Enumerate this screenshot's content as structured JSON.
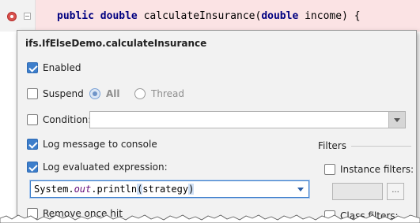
{
  "editor": {
    "code_kw1": "public",
    "code_kw2": "double",
    "code_fn": " calculateInsurance(",
    "code_kw3": "double",
    "code_rest": " income) {"
  },
  "popup": {
    "title": "ifs.IfElseDemo.calculateInsurance",
    "enabled_label": "Enabled",
    "enabled_checked": true,
    "suspend_label": "Suspend",
    "suspend_checked": false,
    "all_label": "All",
    "thread_label": "Thread",
    "suspend_policy": "All",
    "condition_label": "Condition:",
    "condition_checked": false,
    "condition_value": "",
    "log_message_label": "Log message to console",
    "log_message_checked": true,
    "log_expression_label": "Log evaluated expression:",
    "log_expression_checked": true,
    "expression": {
      "prefix": "System.",
      "out": "out",
      "middle": ".println",
      "paren_open": "(",
      "arg": "strategy",
      "paren_close": ")"
    },
    "remove_once_hit_label": "Remove once hit",
    "remove_once_hit_checked": false,
    "filters_heading": "Filters",
    "instance_filters_label": "Instance filters:",
    "instance_filters_checked": false,
    "instance_filters_value": "",
    "browse_label": "...",
    "class_filters_label": "Class filters:",
    "class_filters_checked": false
  },
  "colors": {
    "accent": "#3d7ecb",
    "editor_line_bg": "#fbe3e4",
    "breakpoint": "#d9534f"
  }
}
